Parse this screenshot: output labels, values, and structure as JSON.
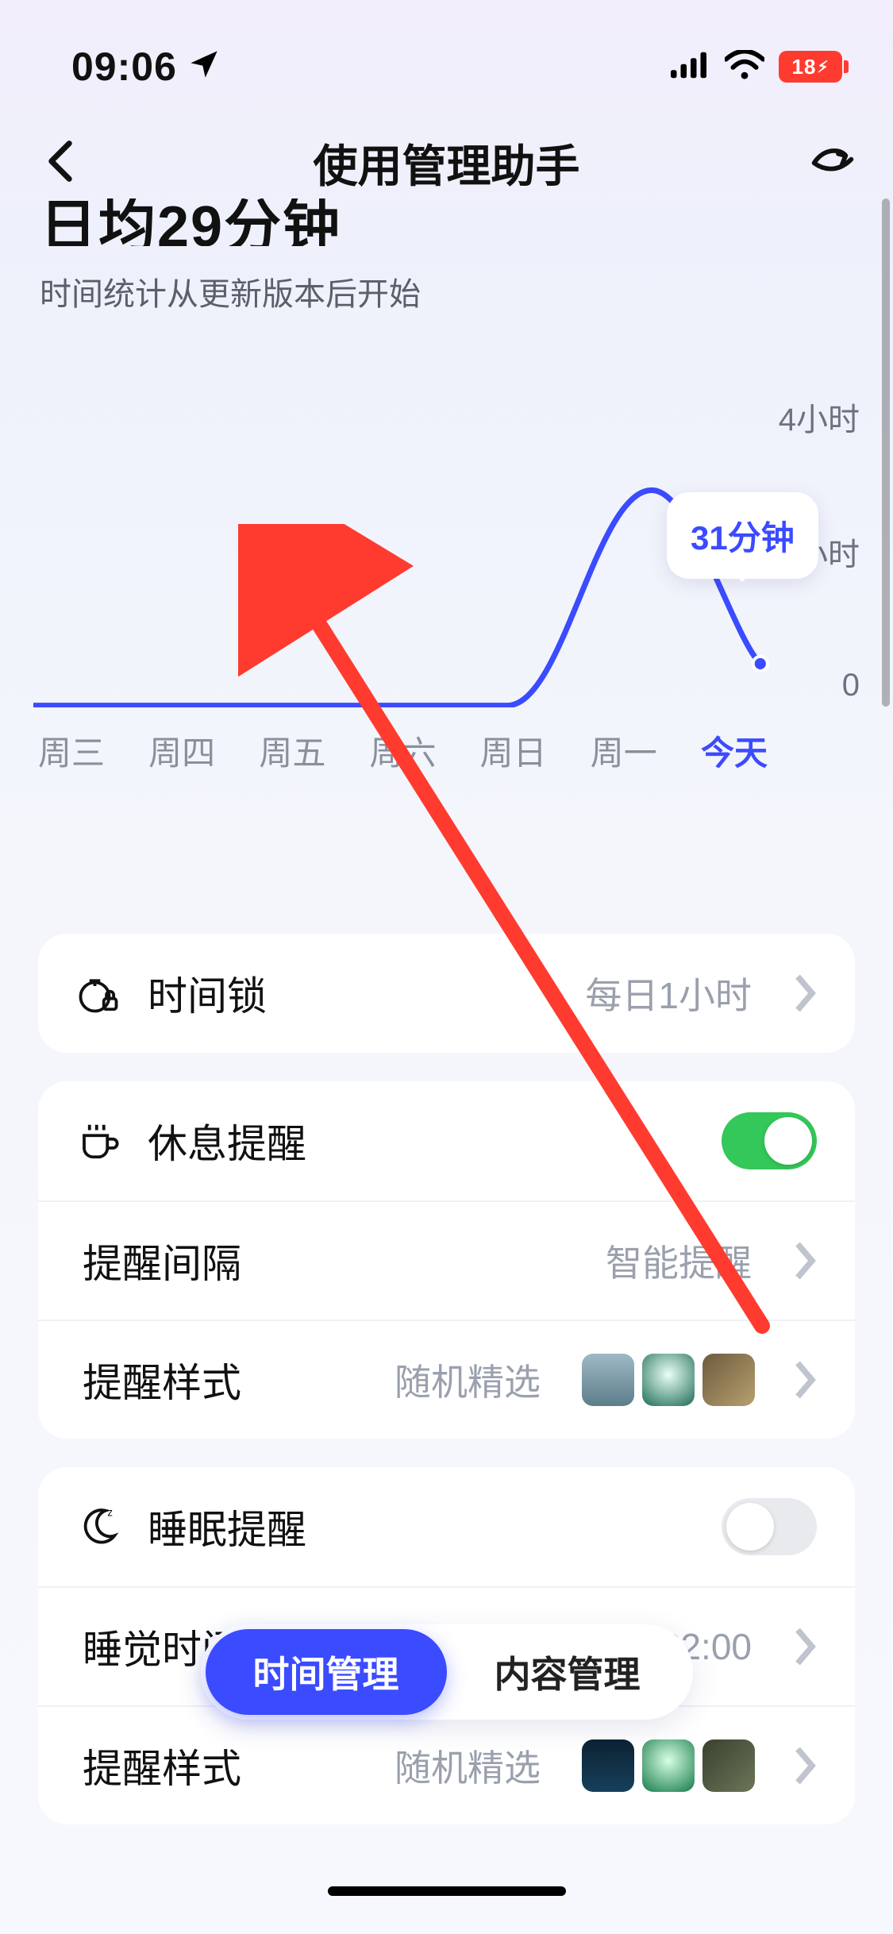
{
  "status": {
    "time": "09:06",
    "battery_text": "18"
  },
  "nav": {
    "title": "使用管理助手"
  },
  "summary": {
    "headline": "日均29分钟",
    "subline": "时间统计从更新版本后开始"
  },
  "chart_data": {
    "type": "line",
    "categories": [
      "周三",
      "周四",
      "周五",
      "周六",
      "周日",
      "周一",
      "今天"
    ],
    "values_minutes": [
      0,
      0,
      0,
      0,
      0,
      170,
      31
    ],
    "yticks_hours": [
      "4小时",
      "小时",
      "0"
    ],
    "ylim_minutes": [
      0,
      240
    ],
    "tooltip_label": "31分钟",
    "active_index": 6
  },
  "lock": {
    "label": "时间锁",
    "value": "每日1小时"
  },
  "rest": {
    "label": "休息提醒",
    "enabled": true,
    "interval_label": "提醒间隔",
    "interval_value": "智能提醒",
    "style_label": "提醒样式",
    "style_value": "随机精选"
  },
  "sleep": {
    "label": "睡眠提醒",
    "enabled": false,
    "time_label": "睡觉时间",
    "time_value": "22:00",
    "style_label": "提醒样式",
    "style_value": "随机精选"
  },
  "tabs": {
    "time": "时间管理",
    "content": "内容管理"
  }
}
